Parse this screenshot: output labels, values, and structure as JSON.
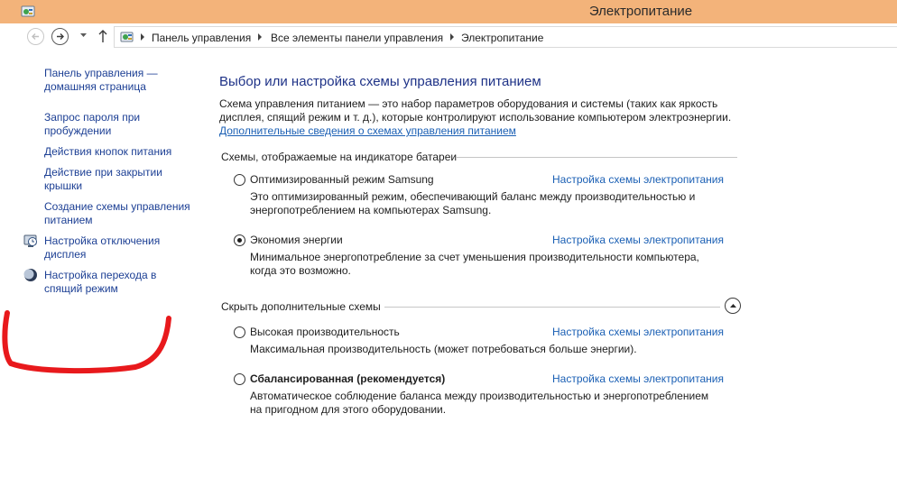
{
  "window": {
    "title": "Электропитание",
    "titlebar_color": "#f3b37a"
  },
  "icons": {
    "app": "control-panel-icon",
    "back": "back-arrow-icon",
    "forward": "forward-arrow-icon",
    "dropdown": "chevron-down-icon",
    "up": "up-arrow-icon"
  },
  "breadcrumbs": [
    "Панель управления",
    "Все элементы панели управления",
    "Электропитание"
  ],
  "sidebar": {
    "home_link": [
      "Панель управления —",
      "домашняя страница"
    ],
    "items": [
      {
        "lines": [
          "Запрос пароля при",
          "пробуждении"
        ],
        "icon": ""
      },
      {
        "lines": [
          "Действия кнопок питания"
        ],
        "icon": ""
      },
      {
        "lines": [
          "Действие при закрытии",
          "крышки"
        ],
        "icon": ""
      },
      {
        "lines": [
          "Создание схемы управления",
          "питанием"
        ],
        "icon": ""
      },
      {
        "lines": [
          "Настройка отключения",
          "дисплея"
        ],
        "icon": "display-clock-icon"
      },
      {
        "lines": [
          "Настройка перехода в",
          "спящий режим"
        ],
        "icon": "moon-icon"
      }
    ]
  },
  "main": {
    "title": "Выбор или настройка схемы управления питанием",
    "description": [
      "Схема управления питанием — это набор параметров оборудования и системы (таких как яркость",
      "дисплея, спящий режим и т. д.), которые контролируют использование компьютером электроэнергии."
    ],
    "more_link": "Дополнительные сведения о схемах управления питанием",
    "section_shown": "Схемы, отображаемые на индикаторе батареи",
    "section_hidden": "Скрыть дополнительные схемы",
    "configure_label": "Настройка схемы электропитания",
    "plans": [
      {
        "name": "Оптимизированный режим Samsung",
        "selected": false,
        "bold": false,
        "desc": [
          "Это оптимизированный режим, обеспечивающий баланс между производительностью и",
          "энергопотреблением на компьютерах Samsung."
        ]
      },
      {
        "name": "Экономия энергии",
        "selected": true,
        "bold": false,
        "desc": [
          "Минимальное энергопотребление за счет уменьшения производительности компьютера,",
          "когда это возможно."
        ]
      },
      {
        "name": "Высокая производительность",
        "selected": false,
        "bold": false,
        "desc": [
          "Максимальная производительность (может потребоваться больше энергии)."
        ]
      },
      {
        "name": "Сбалансированная (рекомендуется)",
        "selected": false,
        "bold": true,
        "desc": [
          "Автоматическое соблюдение баланса между производительностью и энергопотреблением",
          "на пригодном для этого оборудовании."
        ]
      }
    ]
  },
  "colors": {
    "link": "#1a5fb4",
    "sidebar_link": "#1c3f94",
    "title": "#1e3287",
    "annotation": "#e8191c"
  }
}
